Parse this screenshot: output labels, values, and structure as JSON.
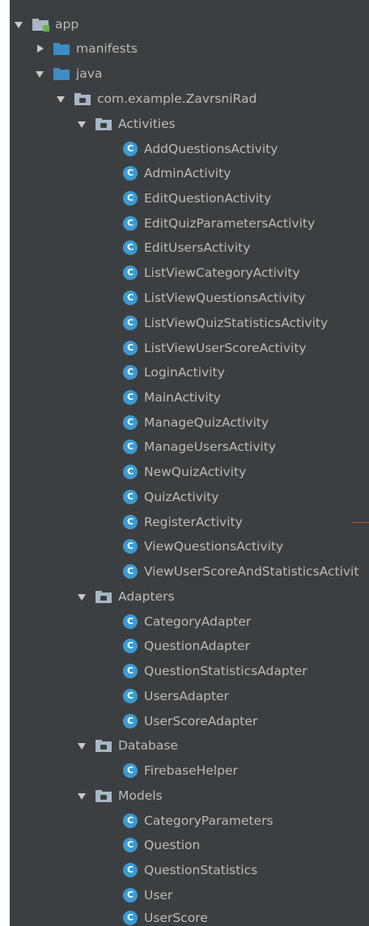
{
  "project_tree": {
    "root": {
      "label": "app"
    },
    "manifests": {
      "label": "manifests"
    },
    "java": {
      "label": "java"
    },
    "package": {
      "label": "com.example.ZavrsniRad"
    },
    "activities": {
      "label": "Activities",
      "items": [
        "AddQuestionsActivity",
        "AdminActivity",
        "EditQuestionActivity",
        "EditQuizParametersActivity",
        "EditUsersActivity",
        "ListViewCategoryActivity",
        "ListViewQuestionsActivity",
        "ListViewQuizStatisticsActivity",
        "ListViewUserScoreActivity",
        "LoginActivity",
        "MainActivity",
        "ManageQuizActivity",
        "ManageUsersActivity",
        "NewQuizActivity",
        "QuizActivity",
        "RegisterActivity",
        "ViewQuestionsActivity",
        "ViewUserScoreAndStatisticsActivit"
      ]
    },
    "adapters": {
      "label": "Adapters",
      "items": [
        "CategoryAdapter",
        "QuestionAdapter",
        "QuestionStatisticsAdapter",
        "UsersAdapter",
        "UserScoreAdapter"
      ]
    },
    "database": {
      "label": "Database",
      "items": [
        "FirebaseHelper"
      ]
    },
    "models": {
      "label": "Models",
      "items": [
        "CategoryParameters",
        "Question",
        "QuestionStatistics",
        "User",
        "UserScore"
      ]
    },
    "class_icon_letter": "C"
  }
}
